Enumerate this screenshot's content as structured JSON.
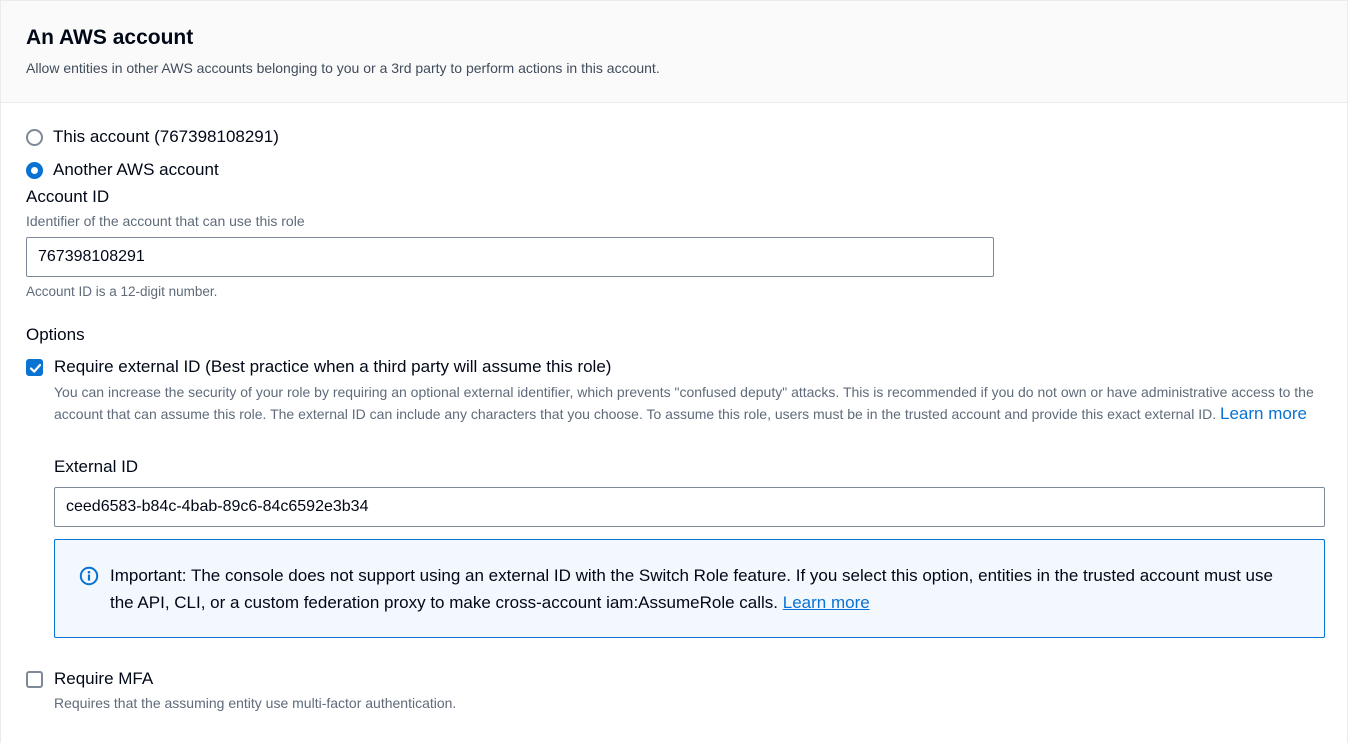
{
  "header": {
    "title": "An AWS account",
    "description": "Allow entities in other AWS accounts belonging to you or a 3rd party to perform actions in this account."
  },
  "account_choice": {
    "options": [
      {
        "label": "This account (767398108291)",
        "selected": false
      },
      {
        "label": "Another AWS account",
        "selected": true
      }
    ]
  },
  "account_id": {
    "label": "Account ID",
    "description": "Identifier of the account that can use this role",
    "value": "767398108291",
    "constraint": "Account ID is a 12-digit number."
  },
  "options": {
    "label": "Options",
    "external_id_checkbox": {
      "label": "Require external ID (Best practice when a third party will assume this role)",
      "checked": true,
      "description": "You can increase the security of your role by requiring an optional external identifier, which prevents \"confused deputy\" attacks. This is recommended if you do not own or have administrative access to the account that can assume this role. The external ID can include any characters that you choose. To assume this role, users must be in the trusted account and provide this exact external ID.",
      "learn_more": "Learn more"
    },
    "external_id": {
      "label": "External ID",
      "value": "ceed6583-b84c-4bab-89c6-84c6592e3b34"
    },
    "alert": {
      "icon": "info-icon",
      "text": "Important: The console does not support using an external ID with the Switch Role feature. If you select this option, entities in the trusted account must use the API, CLI, or a custom federation proxy to make cross-account iam:AssumeRole calls.",
      "learn_more": "Learn more"
    },
    "mfa_checkbox": {
      "label": "Require MFA",
      "checked": false,
      "description": "Requires that the assuming entity use multi-factor authentication."
    }
  },
  "colors": {
    "accent": "#0972d3",
    "alert_background": "#f2f8fd",
    "header_background": "#fafafa"
  }
}
